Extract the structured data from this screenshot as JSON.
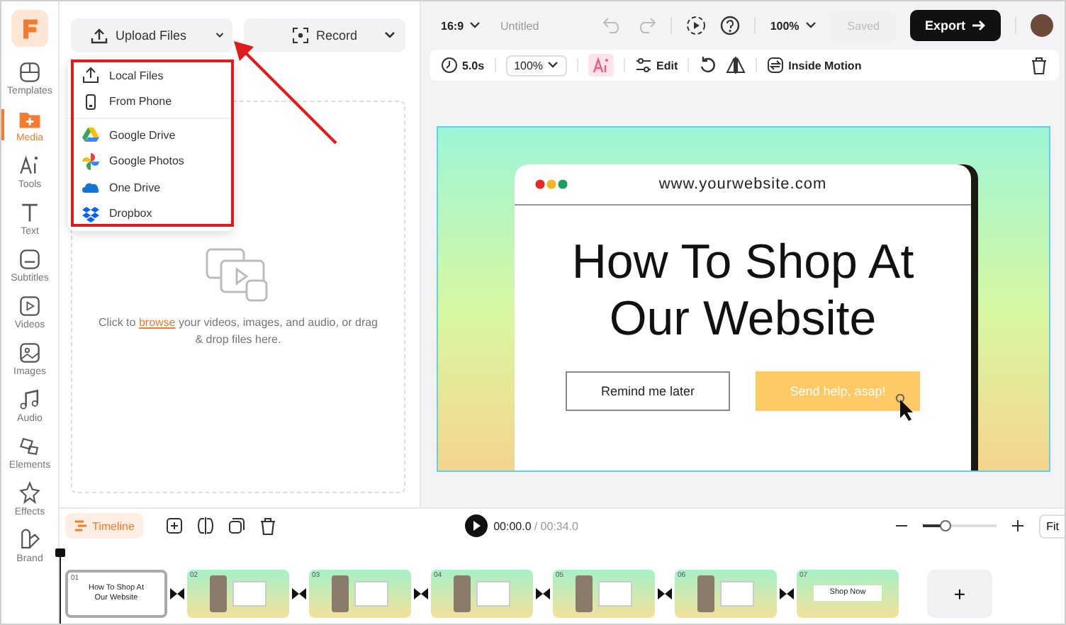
{
  "sidebar": {
    "items": [
      {
        "label": "Templates",
        "selected": false
      },
      {
        "label": "Media",
        "selected": true
      },
      {
        "label": "Tools",
        "selected": false
      },
      {
        "label": "Text",
        "selected": false
      },
      {
        "label": "Subtitles",
        "selected": false
      },
      {
        "label": "Videos",
        "selected": false
      },
      {
        "label": "Images",
        "selected": false
      },
      {
        "label": "Audio",
        "selected": false
      },
      {
        "label": "Elements",
        "selected": false
      },
      {
        "label": "Effects",
        "selected": false
      },
      {
        "label": "Brand",
        "selected": false
      }
    ]
  },
  "media_panel": {
    "upload_button": "Upload Files",
    "record_button": "Record",
    "dropdown": {
      "groups": [
        {
          "items": [
            {
              "label": "Local Files"
            },
            {
              "label": "From Phone"
            }
          ]
        },
        {
          "items": [
            {
              "label": "Google Drive"
            },
            {
              "label": "Google Photos"
            },
            {
              "label": "One Drive"
            },
            {
              "label": "Dropbox"
            }
          ]
        }
      ]
    },
    "drop_zone": {
      "text_before": "Click to ",
      "link": "browse",
      "text_after": " your videos, images, and audio, or drag & drop files here."
    }
  },
  "top_bar": {
    "aspect": "16:9",
    "title": "Untitled",
    "zoom": "100%",
    "saved": "Saved",
    "saved_disabled": true,
    "export": "Export"
  },
  "clip_toolbar": {
    "duration": "5.0s",
    "scale": "100%",
    "edit": "Edit",
    "motion": "Inside Motion"
  },
  "canvas": {
    "url": "www.yourwebsite.com",
    "heading": "How To Shop At Our Website",
    "secondary_button": "Remind me later",
    "primary_button": "Send help, asap!"
  },
  "timeline": {
    "label": "Timeline",
    "time": "00:00.0",
    "duration": "/ 00:34.0",
    "zoom": {
      "level": 0.3
    },
    "fit": "Fit",
    "clips": [
      {
        "number": "01",
        "caption": "How To Shop At Our Website",
        "selected": true
      },
      {
        "number": "02",
        "selected": false
      },
      {
        "number": "03",
        "selected": false
      },
      {
        "number": "04",
        "selected": false
      },
      {
        "number": "05",
        "selected": false
      },
      {
        "number": "06",
        "selected": false
      },
      {
        "number": "07",
        "caption": "Shop Now",
        "selected": false
      }
    ],
    "add": "+"
  }
}
